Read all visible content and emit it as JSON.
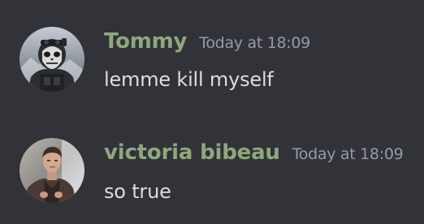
{
  "theme": {
    "background": "#313338",
    "username_color": "#8fa77f",
    "timestamp_color": "#949ba4",
    "text_color": "#dbdee1"
  },
  "messages": [
    {
      "author": "Tommy",
      "timestamp": "Today at 18:09",
      "content": "lemme kill myself",
      "avatar_icon": "masked-soldier-avatar"
    },
    {
      "author": "victoria bibeau",
      "timestamp": "Today at 18:09",
      "content": "so true",
      "avatar_icon": "man-portrait-avatar"
    }
  ]
}
